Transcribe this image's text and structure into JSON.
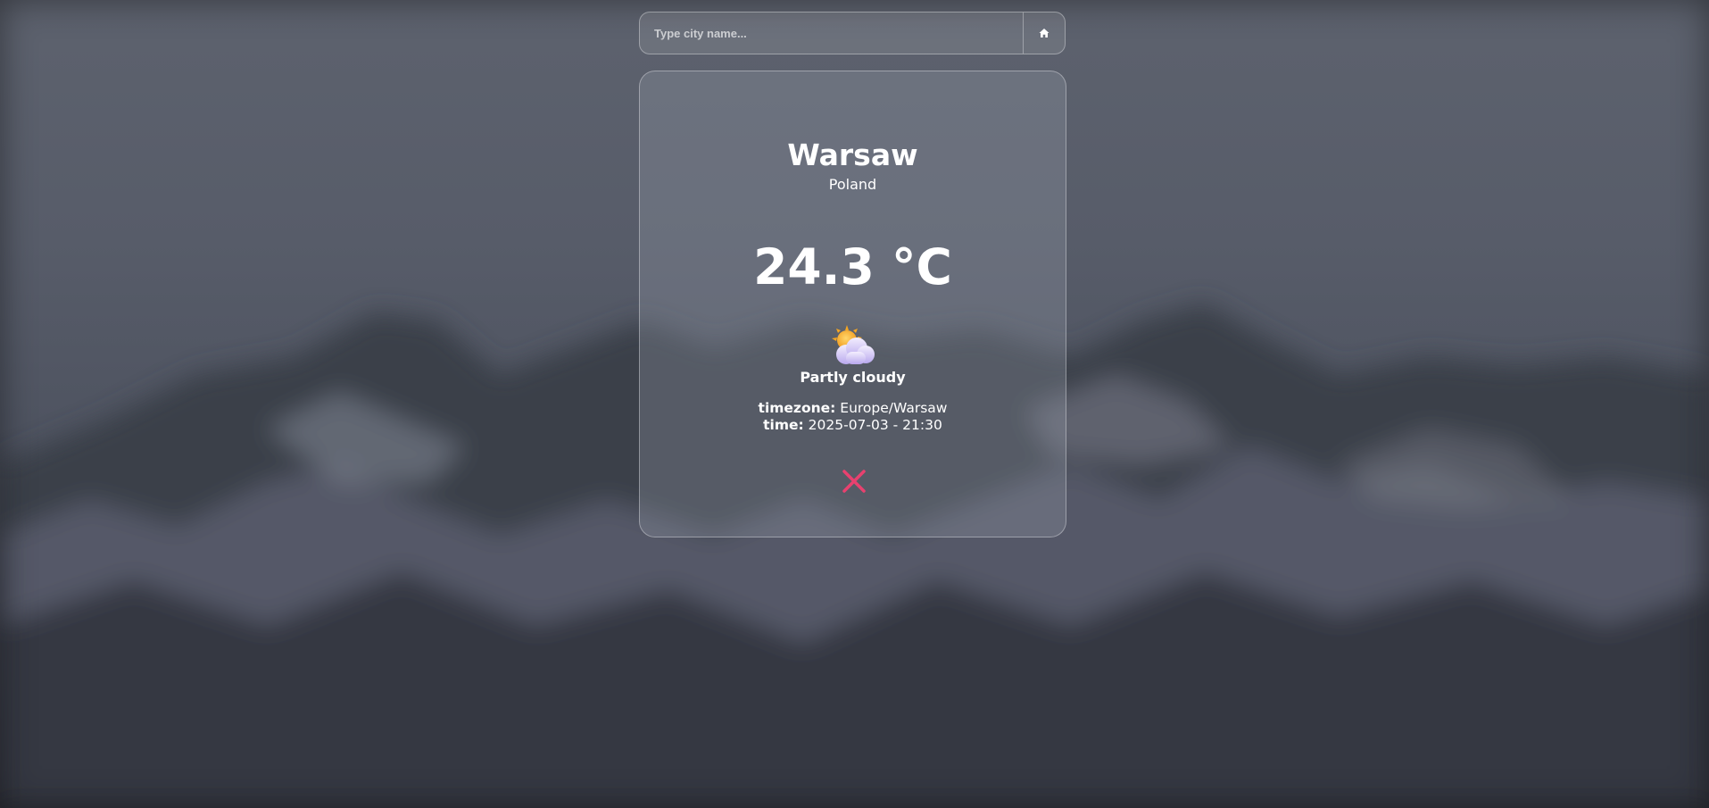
{
  "search": {
    "placeholder": "Type city name...",
    "value": "",
    "home_icon": "home-icon"
  },
  "weather": {
    "city": "Warsaw",
    "country": "Poland",
    "temperature": "24.3 °C",
    "condition": "Partly cloudy",
    "condition_icon": "partly-cloudy-icon",
    "timezone_label": "timezone:",
    "timezone": "Europe/Warsaw",
    "time_label": "time:",
    "time": "2025-07-03 - 21:30",
    "close_icon": "close-icon"
  },
  "colors": {
    "close": "#e8416f",
    "text": "#ffffff"
  }
}
